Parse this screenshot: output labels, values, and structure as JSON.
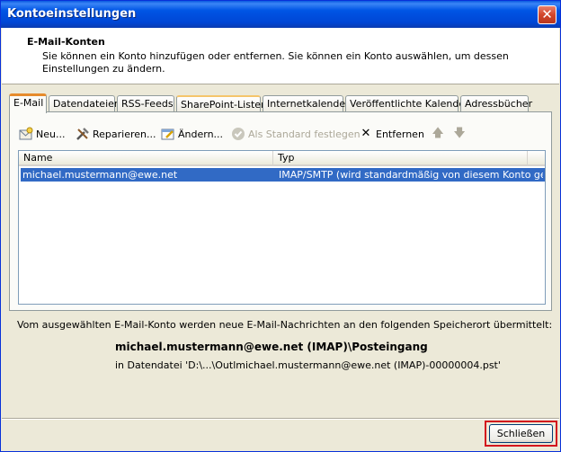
{
  "window": {
    "title": "Kontoeinstellungen",
    "close_symbol": "✕"
  },
  "header": {
    "title": "E-Mail-Konten",
    "description": "Sie können ein Konto hinzufügen oder entfernen. Sie können ein Konto auswählen, um dessen Einstellungen zu ändern."
  },
  "tabs": [
    {
      "label": "E-Mail"
    },
    {
      "label": "Datendateien"
    },
    {
      "label": "RSS-Feeds"
    },
    {
      "label": "SharePoint-Listen"
    },
    {
      "label": "Internetkalender"
    },
    {
      "label": "Veröffentlichte Kalender"
    },
    {
      "label": "Adressbücher"
    }
  ],
  "toolbar": {
    "new_label": "Neu...",
    "repair_label": "Reparieren...",
    "change_label": "Ändern...",
    "default_label": "Als Standard festlegen",
    "remove_label": "Entfernen",
    "remove_symbol": "✕",
    "up_symbol": "🡅",
    "down_symbol": "🡇"
  },
  "accounts_table": {
    "columns": [
      "Name",
      "Typ"
    ],
    "rows": [
      {
        "name": "michael.mustermann@ewe.net",
        "type": "IMAP/SMTP (wird standardmäßig von diesem Konto ge..."
      }
    ]
  },
  "delivery": {
    "text": "Vom ausgewählten E-Mail-Konto werden neue E-Mail-Nachrichten an den folgenden Speicherort übermittelt:",
    "store": "michael.mustermann@ewe.net (IMAP)\\Posteingang",
    "file": "in Datendatei 'D:\\...\\Outlmichael.mustermann@ewe.net (IMAP)-00000004.pst'"
  },
  "footer": {
    "close_button_label": "Schließen"
  },
  "colors": {
    "selection": "#316ac5",
    "highlight_frame": "#d2151d",
    "title_bar": "#0055e5"
  }
}
